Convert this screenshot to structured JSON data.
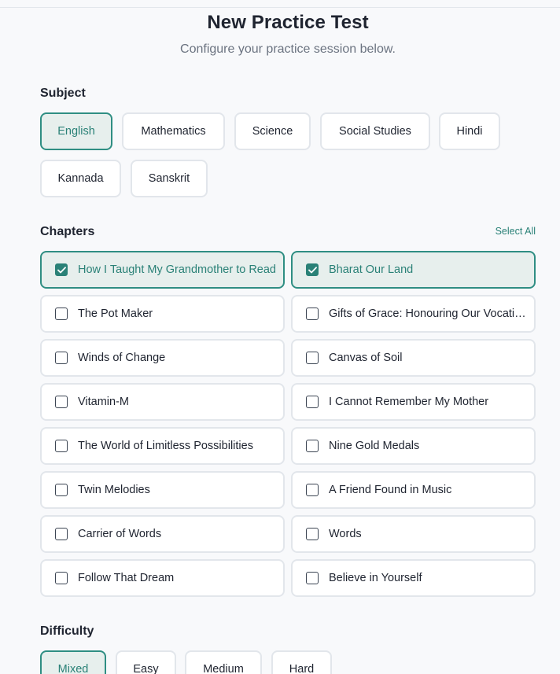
{
  "header": {
    "title": "New Practice Test",
    "subtitle": "Configure your practice session below."
  },
  "subject": {
    "label": "Subject",
    "options": [
      "English",
      "Mathematics",
      "Science",
      "Social Studies",
      "Hindi",
      "Kannada",
      "Sanskrit"
    ],
    "selected": "English"
  },
  "chapters": {
    "label": "Chapters",
    "select_all_label": "Select All",
    "items": [
      {
        "label": "How I Taught My Grandmother to Read",
        "checked": true
      },
      {
        "label": "Bharat Our Land",
        "checked": true
      },
      {
        "label": "The Pot Maker",
        "checked": false
      },
      {
        "label": "Gifts of Grace: Honouring Our Vocations",
        "checked": false
      },
      {
        "label": "Winds of Change",
        "checked": false
      },
      {
        "label": "Canvas of Soil",
        "checked": false
      },
      {
        "label": "Vitamin-M",
        "checked": false
      },
      {
        "label": "I Cannot Remember My Mother",
        "checked": false
      },
      {
        "label": "The World of Limitless Possibilities",
        "checked": false
      },
      {
        "label": "Nine Gold Medals",
        "checked": false
      },
      {
        "label": "Twin Melodies",
        "checked": false
      },
      {
        "label": "A Friend Found in Music",
        "checked": false
      },
      {
        "label": "Carrier of Words",
        "checked": false
      },
      {
        "label": "Words",
        "checked": false
      },
      {
        "label": "Follow That Dream",
        "checked": false
      },
      {
        "label": "Believe in Yourself",
        "checked": false
      }
    ]
  },
  "difficulty": {
    "label": "Difficulty",
    "options": [
      "Mixed",
      "Easy",
      "Medium",
      "Hard"
    ],
    "selected": "Mixed"
  },
  "colors": {
    "accent": "#2a8177",
    "accent_border": "#2f8e83",
    "selected_bg": "#e7efed",
    "border": "#e2e6eb",
    "background": "#f8f9fb"
  }
}
